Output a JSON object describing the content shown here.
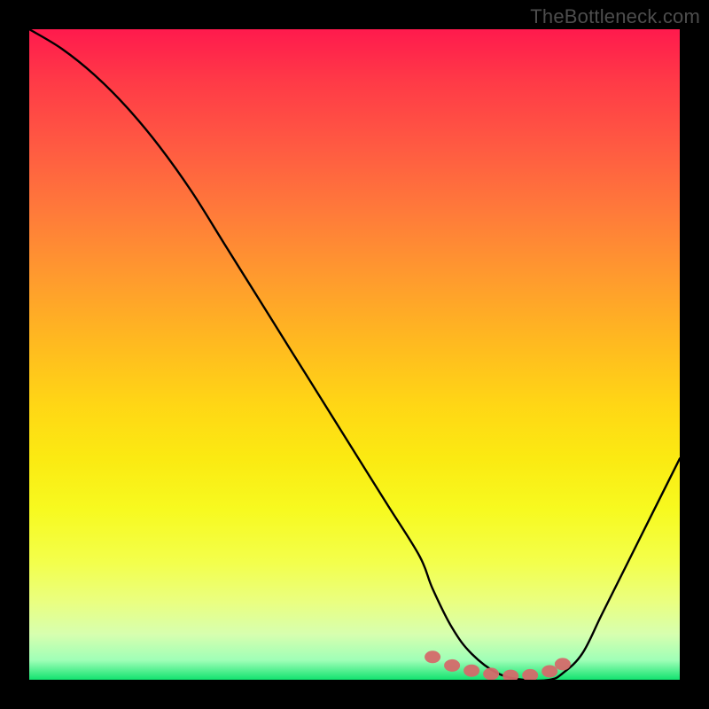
{
  "watermark": "TheBottleneck.com",
  "chart_data": {
    "type": "line",
    "title": "",
    "xlabel": "",
    "ylabel": "",
    "xlim": [
      0,
      100
    ],
    "ylim": [
      0,
      100
    ],
    "series": [
      {
        "name": "bottleneck-curve",
        "x": [
          0,
          5,
          10,
          15,
          20,
          25,
          30,
          35,
          40,
          45,
          50,
          55,
          60,
          62,
          65,
          68,
          72,
          76,
          80,
          82,
          85,
          88,
          92,
          96,
          100
        ],
        "values": [
          100,
          97,
          93,
          88,
          82,
          75,
          67,
          59,
          51,
          43,
          35,
          27,
          19,
          14,
          8,
          4,
          1,
          0,
          0,
          1,
          4,
          10,
          18,
          26,
          34
        ]
      }
    ],
    "markers": {
      "name": "curve-minimum-markers",
      "points": [
        {
          "x": 62,
          "y": 3.5
        },
        {
          "x": 65,
          "y": 2.2
        },
        {
          "x": 68,
          "y": 1.4
        },
        {
          "x": 71,
          "y": 0.9
        },
        {
          "x": 74,
          "y": 0.6
        },
        {
          "x": 77,
          "y": 0.7
        },
        {
          "x": 80,
          "y": 1.3
        },
        {
          "x": 82,
          "y": 2.4
        }
      ],
      "color": "#d46a6a"
    },
    "gradient_colors": {
      "top": "#ff1a4d",
      "mid": "#ffd715",
      "bottom": "#12e36f"
    }
  }
}
